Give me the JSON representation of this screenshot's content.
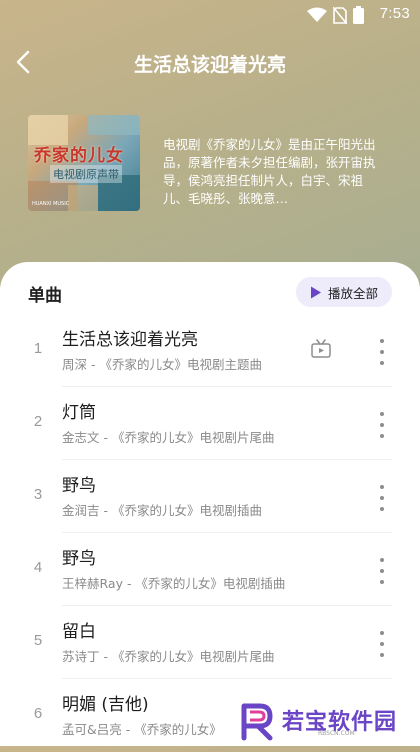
{
  "status_bar": {
    "time": "7:53",
    "icons": [
      "wifi-icon",
      "no-sim-icon",
      "battery-icon"
    ]
  },
  "header": {
    "title": "生活总该迎着光亮",
    "back_icon": "back-arrow-icon"
  },
  "album": {
    "cover_title": "乔家的儿女",
    "cover_subtitle": "电视剧原声带",
    "cover_footer": "HUANXI MUSIC",
    "description": "电视剧《乔家的儿女》是由正午阳光出品，原著作者未夕担任编剧，张开宙执导，侯鸿亮担任制片人，白宇、宋祖儿、毛晓彤、张晚意…"
  },
  "section": {
    "title": "单曲",
    "play_all_label": "播放全部",
    "play_icon": "play-icon"
  },
  "songs": [
    {
      "index": "1",
      "name": "生活总该迎着光亮",
      "meta": "周深 - 《乔家的儿女》电视剧主题曲",
      "has_mv": true
    },
    {
      "index": "2",
      "name": "灯筒",
      "meta": "金志文 - 《乔家的儿女》电视剧片尾曲",
      "has_mv": false
    },
    {
      "index": "3",
      "name": "野鸟",
      "meta": "金润吉 - 《乔家的儿女》电视剧插曲",
      "has_mv": false
    },
    {
      "index": "4",
      "name": "野鸟",
      "meta": "王梓赫Ray - 《乔家的儿女》电视剧插曲",
      "has_mv": false
    },
    {
      "index": "5",
      "name": "留白",
      "meta": "苏诗丁 - 《乔家的儿女》电视剧片尾曲",
      "has_mv": false
    },
    {
      "index": "6",
      "name": "明媚 (吉他)",
      "meta": "孟可&吕亮 - 《乔家的儿女》电视剧插曲",
      "has_mv": false
    }
  ],
  "watermark": {
    "text": "若宝软件园",
    "url": "RBSCN.COM"
  },
  "colors": {
    "accent": "#6a45c6",
    "play_all_bg": "#eeebfb",
    "sheet_bg": "#ffffff"
  }
}
